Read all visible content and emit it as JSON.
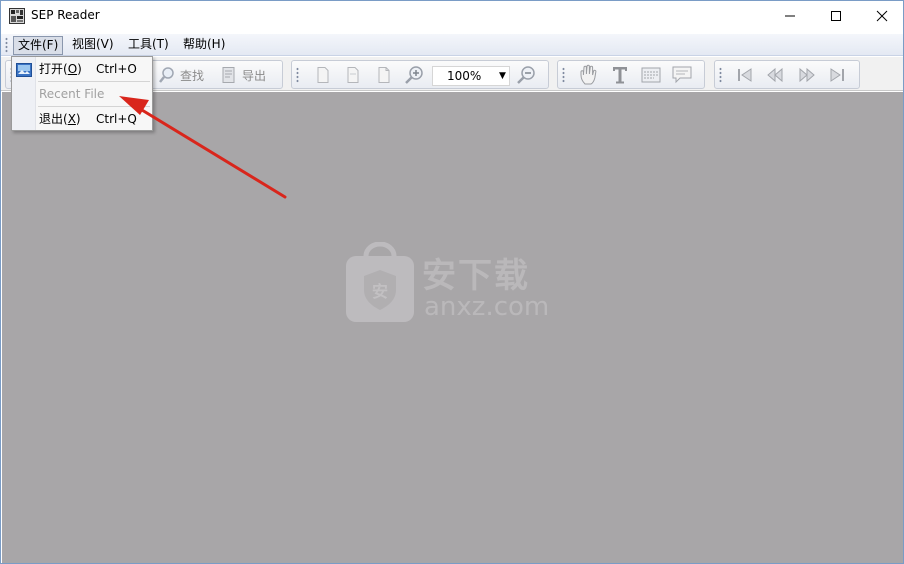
{
  "window": {
    "title": "SEP Reader",
    "controls": [
      "minimize-icon",
      "maximize-icon",
      "close-icon"
    ]
  },
  "menubar": {
    "items": [
      {
        "label": "文件(F)",
        "active": true
      },
      {
        "label": "视图(V)",
        "active": false
      },
      {
        "label": "工具(T)",
        "active": false
      },
      {
        "label": "帮助(H)",
        "active": false
      }
    ]
  },
  "file_menu": {
    "items": [
      {
        "label_pre": "打开(",
        "mnemonic": "O",
        "label_post": ")",
        "shortcut": "Ctrl+O",
        "enabled": true,
        "icon": "open-icon"
      },
      {
        "label": "Recent File",
        "enabled": false
      },
      {
        "label_pre": "退出(",
        "mnemonic": "X",
        "label_post": ")",
        "shortcut": "Ctrl+Q",
        "enabled": true
      }
    ]
  },
  "toolbar": {
    "find_label": "查找",
    "export_label": "导出",
    "zoom_value": "100%"
  },
  "watermark": {
    "text": "安下载",
    "subtext": "anxz.com"
  },
  "colors": {
    "workspace": "#a8a6a8",
    "annotation_arrow": "#d9261c"
  }
}
